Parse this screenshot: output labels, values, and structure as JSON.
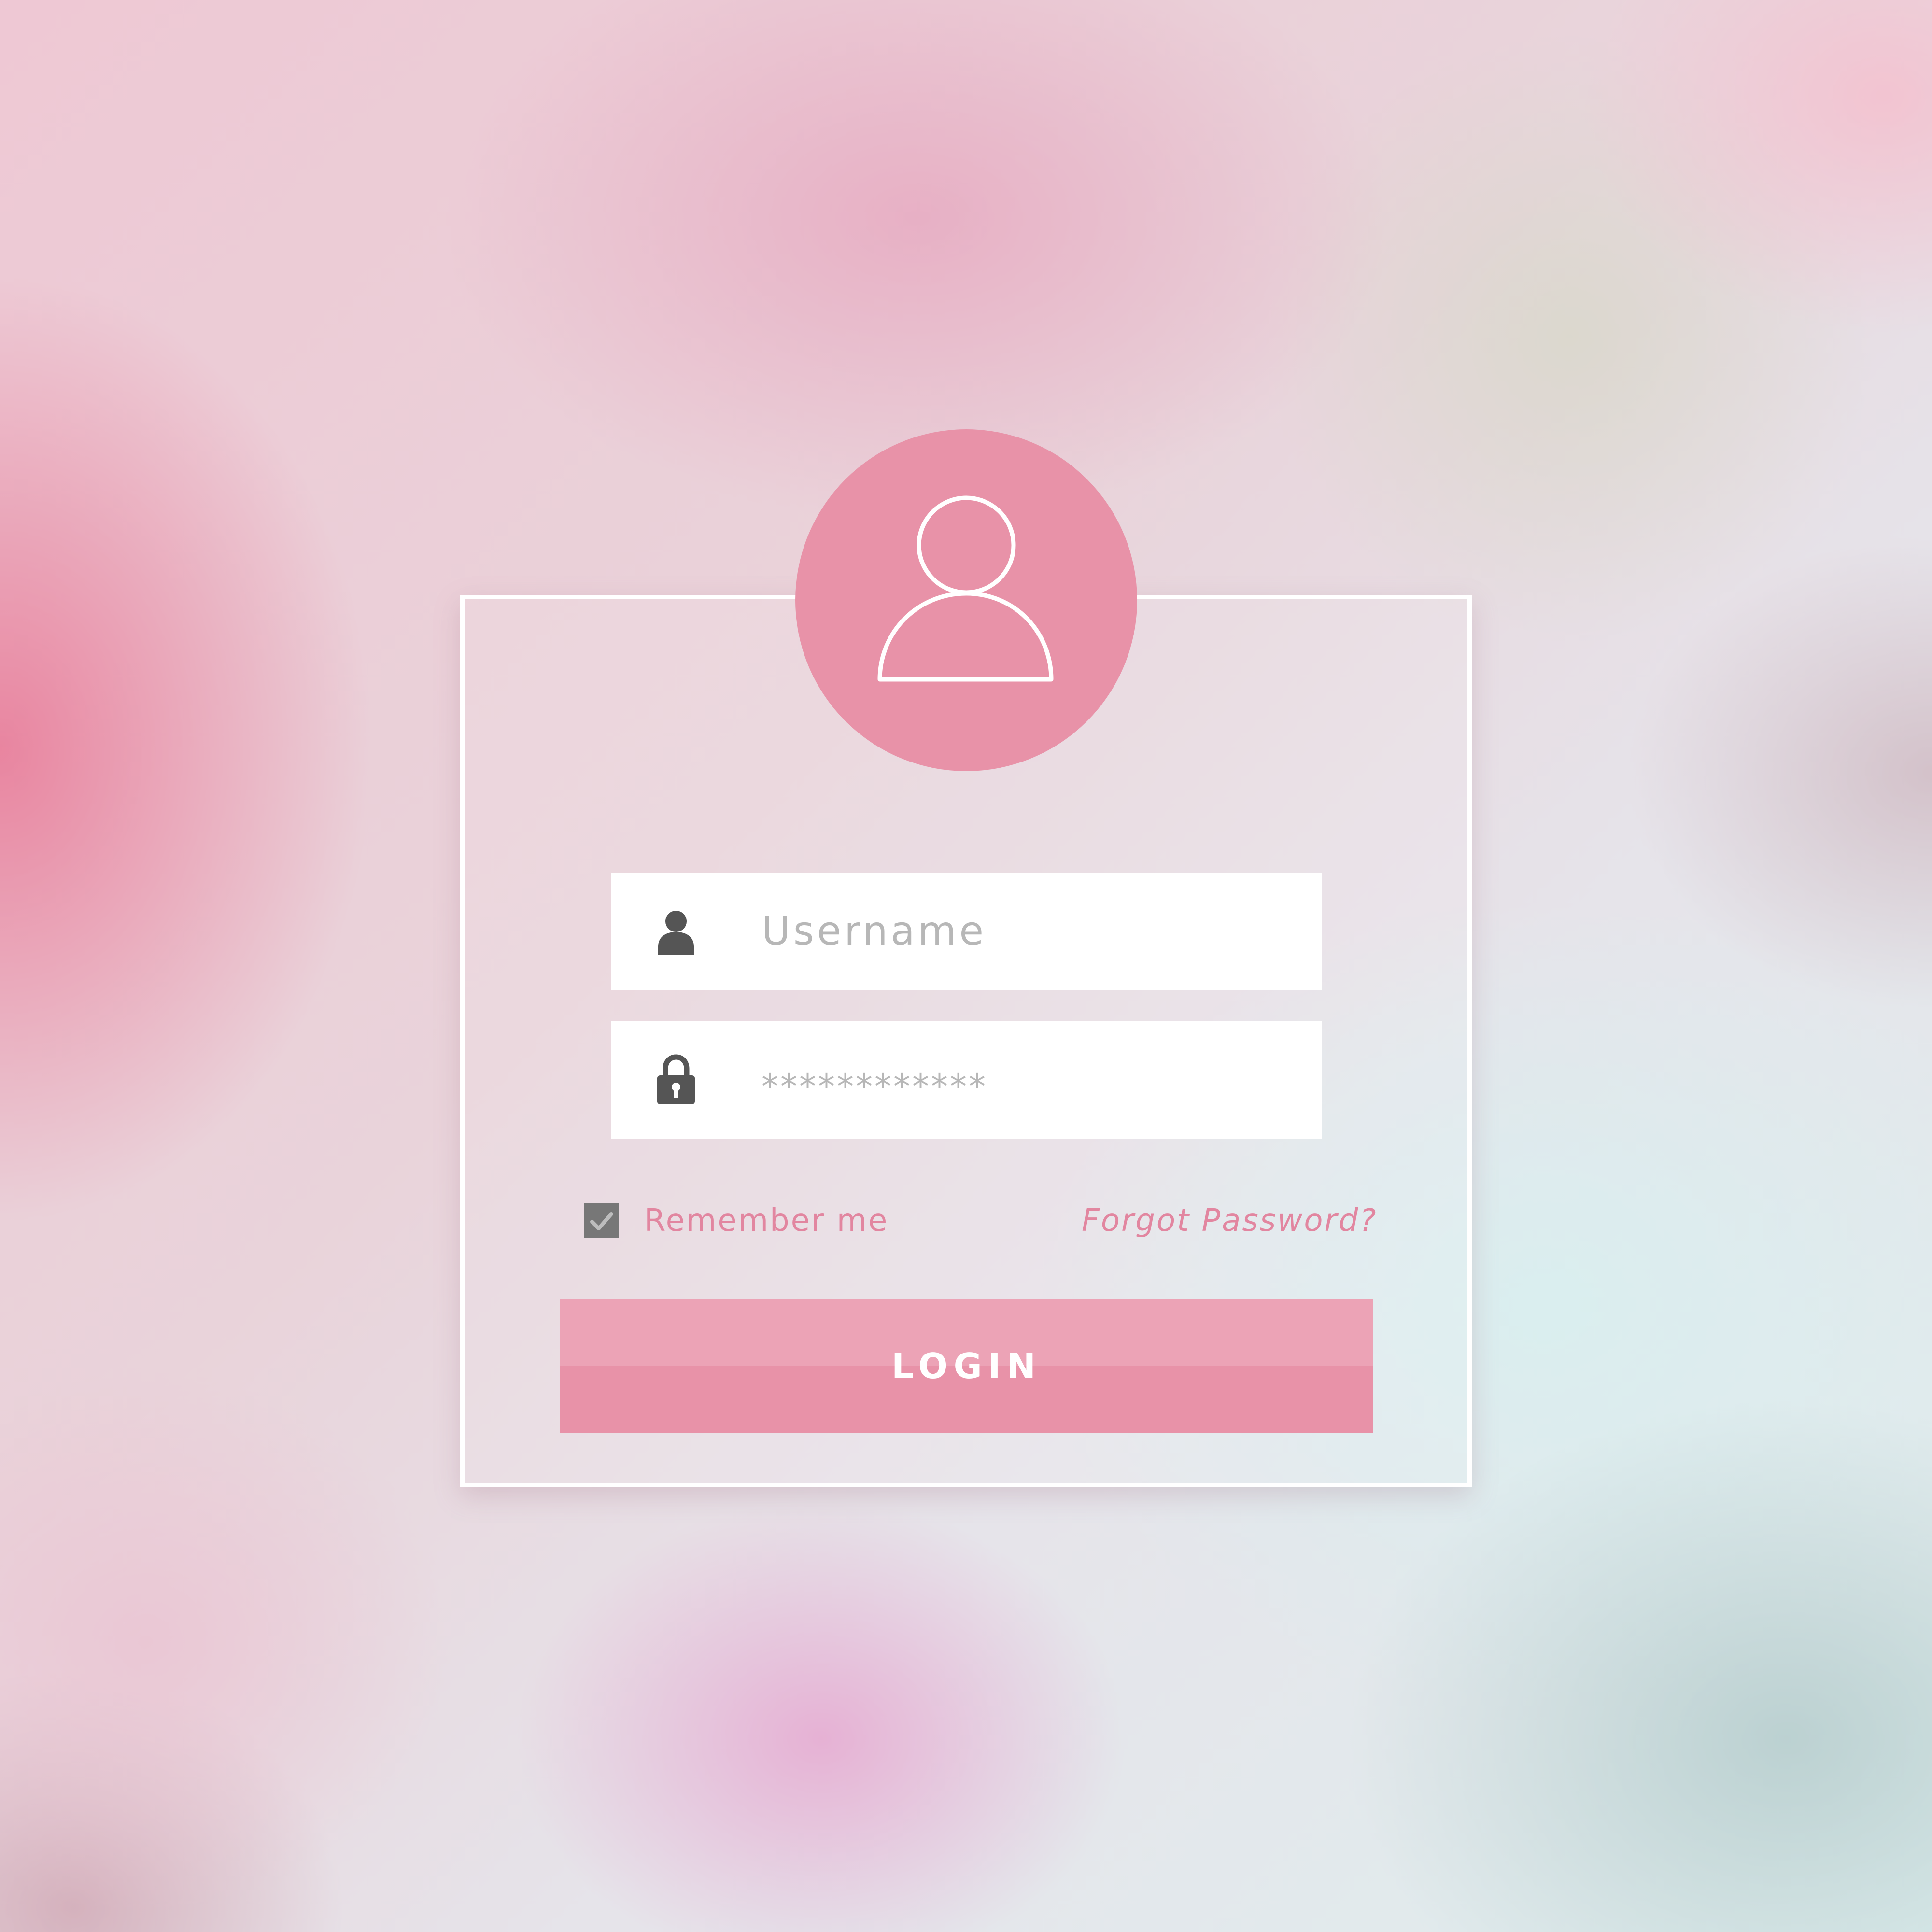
{
  "colors": {
    "accent_pink": "#e892a8",
    "button_top": "#eca3b6",
    "link_pink": "#e286a0",
    "field_bg": "#ffffff",
    "placeholder": "#b7b7b7",
    "icon_dark": "#555555",
    "checkbox_bg": "#777777"
  },
  "login_form": {
    "avatar_icon": "user-outline-icon",
    "username": {
      "icon": "user-icon",
      "placeholder": "Username",
      "value": ""
    },
    "password": {
      "icon": "lock-icon",
      "masked_value": "************"
    },
    "remember_me": {
      "label": "Remember me",
      "checked": true
    },
    "forgot_password_label": "Forgot Password?",
    "login_button_label": "LOGIN"
  }
}
